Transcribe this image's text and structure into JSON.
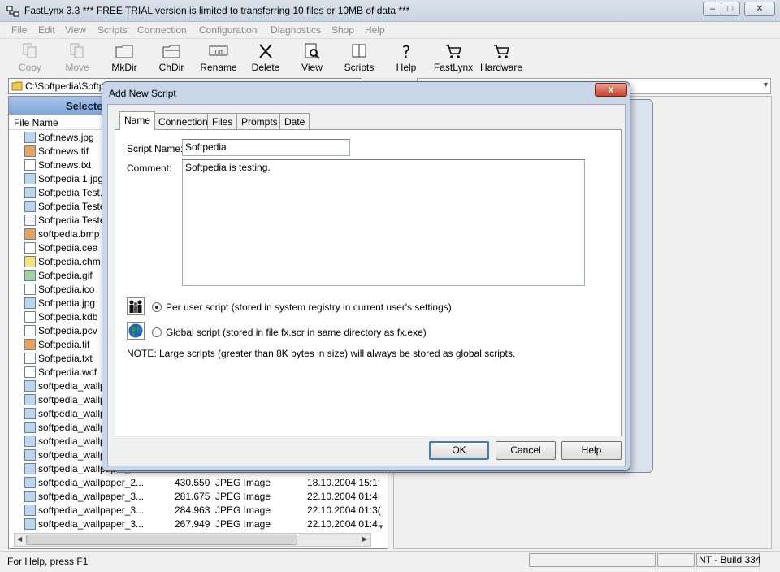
{
  "window": {
    "title": "FastLynx 3.3  *** FREE TRIAL version is limited to transferring 10 files or 10MB of data ***"
  },
  "menu": [
    "File",
    "Edit",
    "View",
    "Scripts",
    "Connection",
    "Configuration",
    "Diagnostics",
    "Shop",
    "Help"
  ],
  "toolbar": [
    {
      "label": "Copy",
      "icon": "copy-icon",
      "enabled": false
    },
    {
      "label": "Move",
      "icon": "move-icon",
      "enabled": false
    },
    {
      "label": "MkDir",
      "icon": "mkdir-icon",
      "enabled": true
    },
    {
      "label": "ChDir",
      "icon": "chdir-icon",
      "enabled": true
    },
    {
      "label": "Rename",
      "icon": "rename-icon",
      "enabled": true
    },
    {
      "label": "Delete",
      "icon": "delete-icon",
      "enabled": true
    },
    {
      "label": "View",
      "icon": "view-icon",
      "enabled": true
    },
    {
      "label": "Scripts",
      "icon": "scripts-icon",
      "enabled": true
    },
    {
      "label": "Help",
      "icon": "help-icon",
      "enabled": true
    },
    {
      "label": "FastLynx",
      "icon": "cart-icon",
      "enabled": true
    },
    {
      "label": "Hardware",
      "icon": "cart-icon",
      "enabled": true
    }
  ],
  "left_pane": {
    "path": "C:\\Softpedia\\Softp",
    "header": "Selecte",
    "column_name": "File Name",
    "files": [
      {
        "name": "Softnews.jpg",
        "icon": "image"
      },
      {
        "name": "Softnews.tif",
        "icon": "tif"
      },
      {
        "name": "Softnews.txt",
        "icon": "doc"
      },
      {
        "name": "Softpedia 1.jpg",
        "icon": "image"
      },
      {
        "name": "Softpedia Test.",
        "icon": "image"
      },
      {
        "name": "Softpedia Teste",
        "icon": "image"
      },
      {
        "name": "Softpedia Teste",
        "icon": "text"
      },
      {
        "name": "softpedia.bmp",
        "icon": "tif"
      },
      {
        "name": "Softpedia.cea",
        "icon": "doc"
      },
      {
        "name": "Softpedia.chm",
        "icon": "help"
      },
      {
        "name": "Softpedia.gif",
        "icon": "gif"
      },
      {
        "name": "Softpedia.ico",
        "icon": "doc"
      },
      {
        "name": "Softpedia.jpg",
        "icon": "image"
      },
      {
        "name": "Softpedia.kdb",
        "icon": "doc"
      },
      {
        "name": "Softpedia.pcv",
        "icon": "doc"
      },
      {
        "name": "Softpedia.tif",
        "icon": "tif"
      },
      {
        "name": "Softpedia.txt",
        "icon": "doc"
      },
      {
        "name": "Softpedia.wcf",
        "icon": "doc"
      },
      {
        "name": "softpedia_wallp",
        "icon": "image"
      },
      {
        "name": "softpedia_wallp",
        "icon": "image"
      },
      {
        "name": "softpedia_wallp",
        "icon": "image"
      },
      {
        "name": "softpedia_wallp",
        "icon": "image"
      },
      {
        "name": "softpedia_wallp",
        "icon": "image"
      },
      {
        "name": "softpedia_wallp",
        "icon": "image"
      },
      {
        "name": "softpedia_wallpaper_",
        "icon": "image"
      },
      {
        "name": "softpedia_wallpaper_2...",
        "size": "430.550",
        "type": "JPEG Image",
        "date": "18.10.2004 15:1:",
        "icon": "image"
      },
      {
        "name": "softpedia_wallpaper_3...",
        "size": "281.675",
        "type": "JPEG Image",
        "date": "22.10.2004 01:4:",
        "icon": "image"
      },
      {
        "name": "softpedia_wallpaper_3...",
        "size": "284.963",
        "type": "JPEG Image",
        "date": "22.10.2004 01:3(",
        "icon": "image"
      },
      {
        "name": "softpedia_wallpaper_3...",
        "size": "267.949",
        "type": "JPEG Image",
        "date": "22.10.2004 01:4:",
        "icon": "image"
      }
    ]
  },
  "statusbar": {
    "text": "For Help, press F1",
    "build": "NT - Build 334"
  },
  "dialog": {
    "title": "Add New Script",
    "close_label": "x",
    "tabs": [
      "Name",
      "Connection",
      "Files",
      "Prompts",
      "Date"
    ],
    "active_tab": 0,
    "script_name_label": "Script Name:",
    "script_name_value": "Softpedia",
    "comment_label": "Comment:",
    "comment_value": "Softpedia is testing.",
    "option_user": "Per user script (stored in system registry in current user's settings)",
    "option_global": "Global script (stored in file fx.scr in same directory as fx.exe)",
    "selected_option": "user",
    "note": "NOTE: Large scripts (greater than 8K bytes in size) will always be stored as global scripts.",
    "ok_label": "OK",
    "cancel_label": "Cancel",
    "help_label": "Help"
  }
}
